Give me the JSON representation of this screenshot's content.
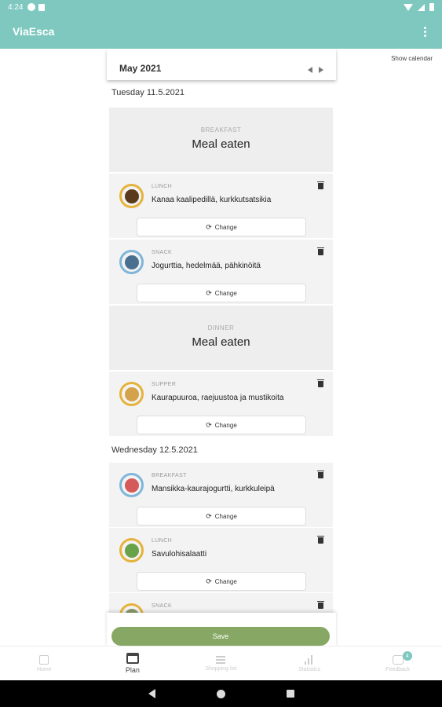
{
  "status_bar": {
    "time": "4:24"
  },
  "app_bar": {
    "title": "ViaEsca"
  },
  "calendar": {
    "month": "May 2021",
    "show_calendar_label": "Show calendar"
  },
  "days": [
    {
      "label": "Tuesday 11.5.2021",
      "meals": [
        {
          "type": "BREAKFAST",
          "status": "Meal eaten"
        },
        {
          "type": "LUNCH",
          "name": "Kanaa kaalipedillä, kurkkutsatsikia",
          "change_label": "Change"
        },
        {
          "type": "SNACK",
          "name": "Jogurttia, hedelmää, pähkinöitä",
          "change_label": "Change"
        },
        {
          "type": "DINNER",
          "status": "Meal eaten"
        },
        {
          "type": "SUPPER",
          "name": "Kaurapuuroa, raejuustoa ja mustikoita",
          "change_label": "Change"
        }
      ]
    },
    {
      "label": "Wednesday 12.5.2021",
      "meals": [
        {
          "type": "BREAKFAST",
          "name": "Mansikka-kaurajogurtti, kurkkuleipä",
          "change_label": "Change"
        },
        {
          "type": "LUNCH",
          "name": "Savulohisalaatti",
          "change_label": "Change"
        },
        {
          "type": "SNACK"
        }
      ]
    }
  ],
  "save_label": "Save",
  "bottom_nav": [
    {
      "label": "Home",
      "icon": "home-icon"
    },
    {
      "label": "Plan",
      "icon": "calendar-icon",
      "active": true
    },
    {
      "label": "Shopping list",
      "icon": "list-icon"
    },
    {
      "label": "Statistics",
      "icon": "stats-icon"
    },
    {
      "label": "Feedback",
      "icon": "chat-icon",
      "badge": "4"
    }
  ],
  "colors": {
    "accent": "#7ec8bf",
    "save": "#86a864"
  }
}
